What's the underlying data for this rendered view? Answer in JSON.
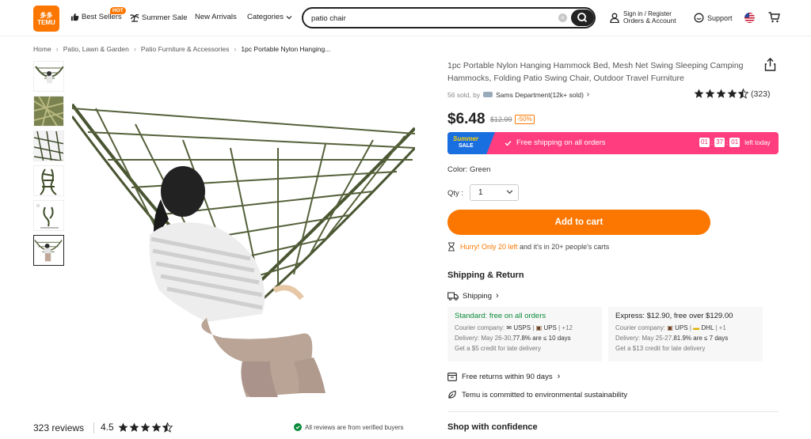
{
  "header": {
    "logo_line1": "多多",
    "logo_line2": "TEMU",
    "best_sellers": "Best Sellers",
    "hot_badge": "HOT",
    "summer_sale": "Summer Sale",
    "new_arrivals": "New Arrivals",
    "categories": "Categories",
    "search_value": "patio chair",
    "signin_line1": "Sign in / Register",
    "signin_line2": "Orders & Account",
    "support": "Support"
  },
  "breadcrumb": [
    "Home",
    "Patio, Lawn & Garden",
    "Patio Furniture & Accessories",
    "1pc Portable Nylon Hanging..."
  ],
  "product": {
    "title": "1pc Portable Nylon Hanging Hammock Bed, Mesh Net Swing Sleeping Camping Hammocks, Folding Patio Swing Chair, Outdoor Travel Furniture",
    "sold": "56 sold, by",
    "store": "Sams Department(12k+ sold)",
    "rating_count": "(323)",
    "rating": 4.5,
    "price": "$6.48",
    "old_price": "$12.99",
    "discount": "-50%",
    "color_label": "Color: Green",
    "qty_label": "Qty :",
    "qty_value": "1",
    "add_to_cart": "Add to cart"
  },
  "banner": {
    "tag_top": "Summer",
    "tag_bottom": "SALE",
    "text": "Free shipping on all orders",
    "timer_h": "01",
    "timer_m": "37",
    "timer_s": "01",
    "timer_label": "left today"
  },
  "hurry": {
    "warn": "Hurry! Only 20 left",
    "rest": "and it's in 20+ people's carts"
  },
  "shipping": {
    "section_title": "Shipping & Return",
    "link": "Shipping",
    "standard": {
      "head": "Standard: free on all orders",
      "courier_label": "Courier company:",
      "courier_1": "USPS",
      "courier_2": "UPS",
      "courier_more": "+12",
      "delivery_label": "Delivery: May 26-30,",
      "delivery_stat": "77.8% are ≤ 10 days",
      "credit": "Get a $5 credit for late delivery"
    },
    "express": {
      "head": "Express: $12.90, free over $129.00",
      "courier_label": "Courier company:",
      "courier_1": "UPS",
      "courier_2": "DHL",
      "courier_more": "+1",
      "delivery_label": "Delivery: May 25-27,",
      "delivery_stat": "81.9% are ≤ 7 days",
      "credit": "Get a $13 credit for late delivery"
    },
    "returns": "Free returns within 90 days",
    "sustainability": "Temu is committed to environmental sustainability"
  },
  "confidence_title": "Shop with confidence",
  "reviews": {
    "count": "323 reviews",
    "rating": "4.5",
    "verified": "All reviews are from verified buyers"
  },
  "colors": {
    "brand_orange": "#fb7701",
    "banner_pink": "#ff3d7f",
    "banner_blue": "#1a6fe0",
    "green": "#0a8a3a"
  }
}
